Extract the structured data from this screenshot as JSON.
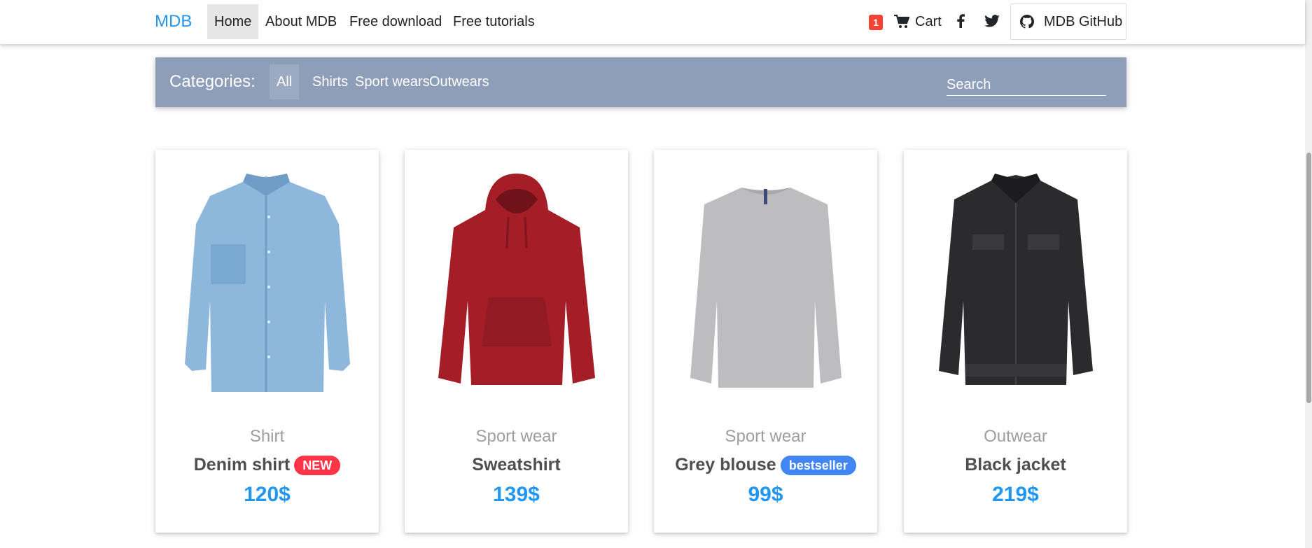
{
  "navbar": {
    "brand": "MDB",
    "links": [
      {
        "label": "Home",
        "active": true
      },
      {
        "label": "About MDB"
      },
      {
        "label": "Free download"
      },
      {
        "label": "Free tutorials"
      }
    ],
    "cart_count": "1",
    "cart_label": "Cart",
    "github_label": "MDB GitHub",
    "icons": [
      "cart-icon",
      "facebook-icon",
      "twitter-icon",
      "github-icon"
    ]
  },
  "categories": {
    "title": "Categories:",
    "items": [
      {
        "label": "All",
        "active": true
      },
      {
        "label": "Shirts"
      },
      {
        "label": "Sport wears"
      },
      {
        "label": "Outwears"
      }
    ],
    "search_placeholder": "Search",
    "bar_color": "#8e9eb9"
  },
  "products": [
    {
      "category": "Shirt",
      "name": "Denim shirt",
      "badge": "NEW",
      "price": "120$",
      "color": "#8db7db"
    },
    {
      "category": "Sport wear",
      "name": "Sweatshirt",
      "badge": "",
      "price": "139$",
      "color": "#a51d27"
    },
    {
      "category": "Sport wear",
      "name": "Grey blouse",
      "badge": "bestseller",
      "price": "99$",
      "color": "#bdbdbf"
    },
    {
      "category": "Outwear",
      "name": "Black jacket",
      "badge": "",
      "price": "219$",
      "color": "#2b2b2d"
    }
  ],
  "colors": {
    "accent": "#2196f3",
    "badge_red": "#ff3547",
    "badge_blue": "#4285f4",
    "count_badge": "#f44336"
  }
}
